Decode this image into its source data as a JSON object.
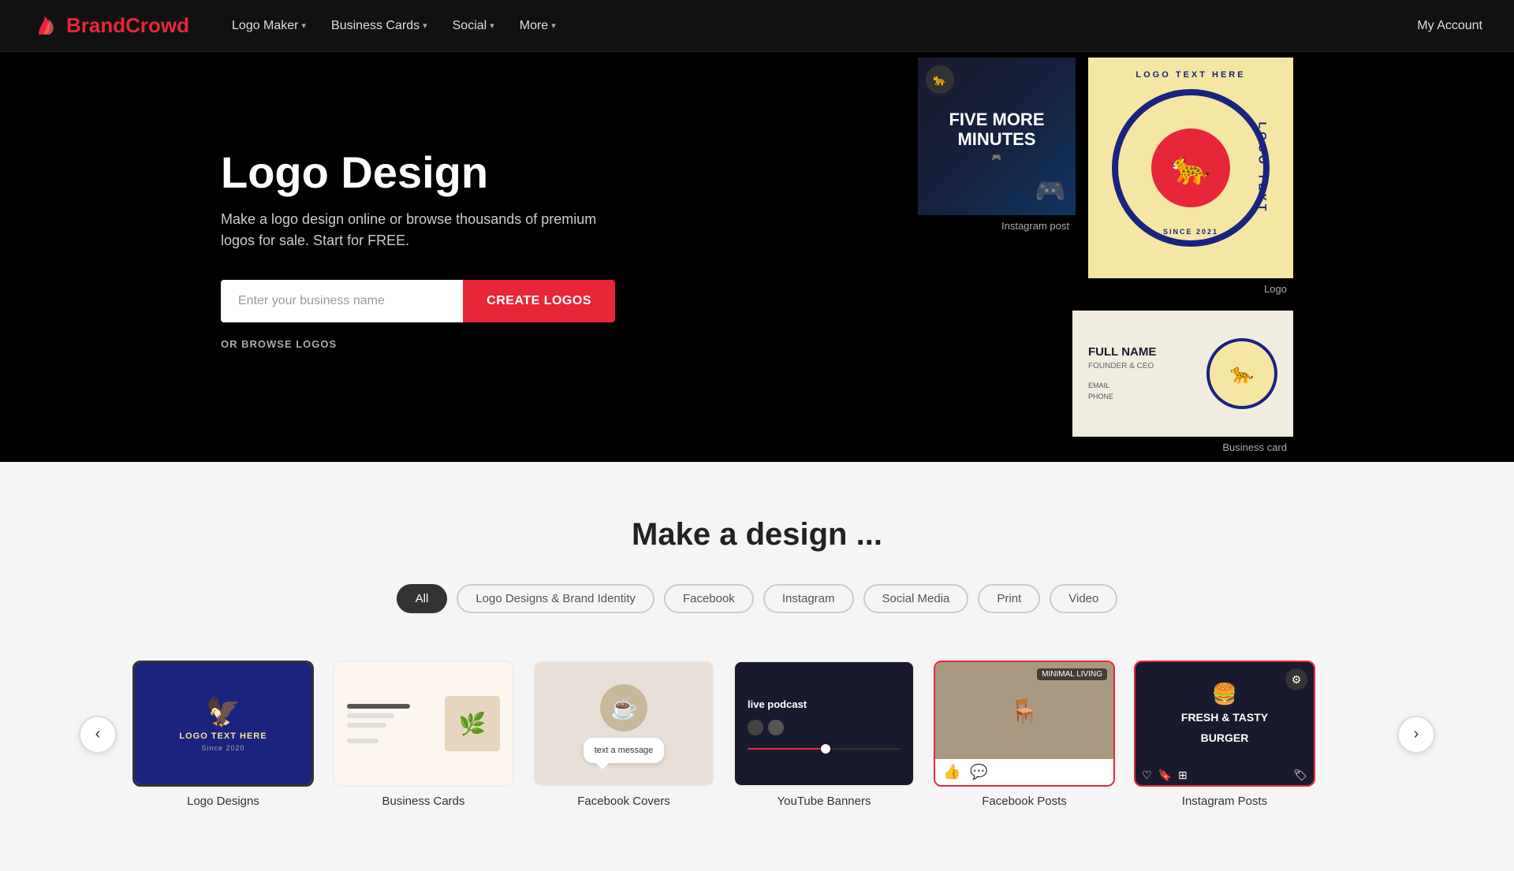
{
  "brand": {
    "name_part1": "Brand",
    "name_part2": "Crowd"
  },
  "navbar": {
    "logo_maker": "Logo Maker",
    "business_cards": "Business Cards",
    "social": "Social",
    "more": "More",
    "my_account": "My Account"
  },
  "hero": {
    "title": "Logo Design",
    "subtitle": "Make a logo design online or browse thousands of premium logos for sale. Start for FREE.",
    "input_placeholder": "Enter your business name",
    "cta_button": "CREATE LOGOS",
    "browse_link": "OR BROWSE LOGOS"
  },
  "hero_cards": {
    "instagram_label": "Instagram post",
    "logo_label": "Logo",
    "business_card_label": "Business card",
    "logo_text": "LOGO TEXT HERE SINCE 2021",
    "logo_text_arc_top": "LOGO TEXT HERE",
    "logo_text_arc_bottom": "SINCE 2021",
    "biz_name": "FULL NAME",
    "biz_title": "FOUNDER & CEO",
    "biz_email": "EMAIL",
    "biz_phone": "PHONE",
    "insta_big": "FIVE MORE\nMINUTES"
  },
  "section_design": {
    "title": "Make a design ...",
    "filters": [
      {
        "label": "All",
        "active": true
      },
      {
        "label": "Logo Designs & Brand Identity",
        "active": false
      },
      {
        "label": "Facebook",
        "active": false
      },
      {
        "label": "Instagram",
        "active": false
      },
      {
        "label": "Social Media",
        "active": false
      },
      {
        "label": "Print",
        "active": false
      },
      {
        "label": "Video",
        "active": false
      }
    ],
    "cards": [
      {
        "label": "Logo Designs",
        "type": "logo"
      },
      {
        "label": "Business Cards",
        "type": "biz"
      },
      {
        "label": "Facebook Covers",
        "type": "fb"
      },
      {
        "label": "YouTube Banners",
        "type": "yt"
      },
      {
        "label": "Facebook Posts",
        "type": "fbpost"
      },
      {
        "label": "Instagram Posts",
        "type": "igpost"
      }
    ],
    "prev_label": "‹",
    "next_label": "›"
  }
}
